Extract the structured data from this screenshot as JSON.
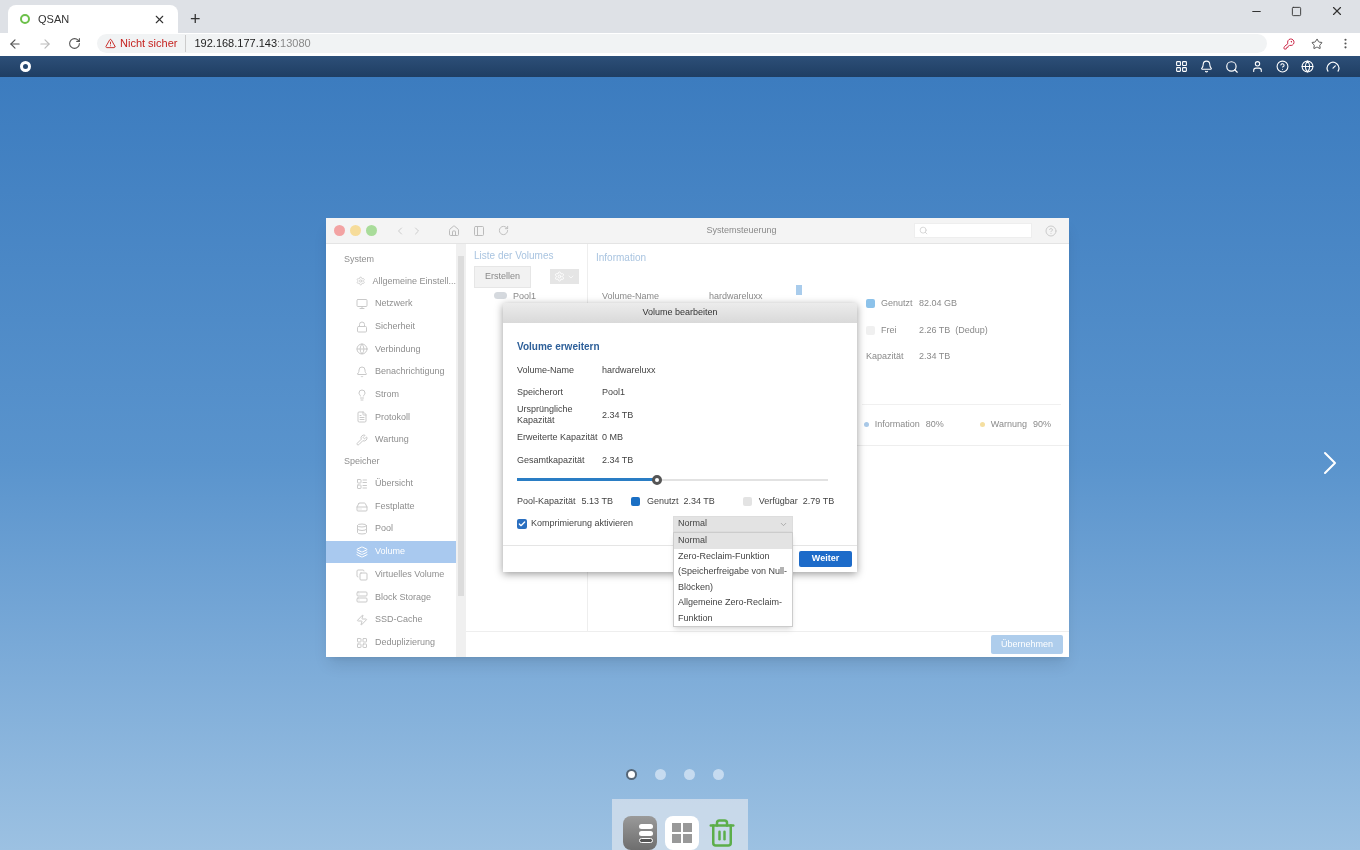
{
  "browser": {
    "tab": {
      "title": "QSAN"
    },
    "new_tab": "+",
    "address": {
      "security": "Nicht sicher",
      "host": "192.168.177.143",
      "port": ":13080"
    }
  },
  "window": {
    "title": "Systemsteuerung"
  },
  "sidebar": {
    "groups": [
      {
        "label": "System",
        "items": [
          {
            "label": "Allgemeine Einstell...",
            "selected": false
          },
          {
            "label": "Netzwerk",
            "selected": false
          },
          {
            "label": "Sicherheit",
            "selected": false
          },
          {
            "label": "Verbindung",
            "selected": false
          },
          {
            "label": "Benachrichtigung",
            "selected": false
          },
          {
            "label": "Strom",
            "selected": false
          },
          {
            "label": "Protokoll",
            "selected": false
          },
          {
            "label": "Wartung",
            "selected": false
          }
        ]
      },
      {
        "label": "Speicher",
        "items": [
          {
            "label": "Übersicht",
            "selected": false
          },
          {
            "label": "Festplatte",
            "selected": false
          },
          {
            "label": "Pool",
            "selected": false
          },
          {
            "label": "Volume",
            "selected": true
          },
          {
            "label": "Virtuelles Volume",
            "selected": false
          },
          {
            "label": "Block Storage",
            "selected": false
          },
          {
            "label": "SSD-Cache",
            "selected": false
          },
          {
            "label": "Deduplizierung",
            "selected": false
          }
        ]
      }
    ]
  },
  "volume_list": {
    "title": "Liste der Volumes",
    "create_button": "Erstellen",
    "tree": [
      {
        "label": "Pool1"
      }
    ]
  },
  "information": {
    "title": "Information",
    "fields": [
      {
        "label": "Volume-Name",
        "value": "hardwareluxx"
      }
    ],
    "legend": [
      {
        "label": "Genutzt",
        "value": "82.04 GB",
        "color": "#8cc2ea"
      },
      {
        "label": "Frei",
        "value": "2.26 TB  (Dedup)",
        "color": "#f0f0f0"
      }
    ],
    "capacity": {
      "label": "Kapazität",
      "value": "2.34 TB"
    },
    "thresholds": [
      {
        "label": "Information",
        "value": "80%",
        "color": "#a9c9e8"
      },
      {
        "label": "Warnung",
        "value": "90%",
        "color": "#f5dfa0"
      }
    ]
  },
  "apply_button": {
    "label": "Übernehmen",
    "disabled": true
  },
  "dialog": {
    "title": "Volume bearbeiten",
    "section": "Volume erweitern",
    "fields": [
      {
        "label": "Volume-Name",
        "value": "hardwareluxx"
      },
      {
        "label": "Speicherort",
        "value": "Pool1"
      },
      {
        "label": "Ursprüngliche Kapazität",
        "value": "2.34 TB"
      },
      {
        "label": "Erweiterte Kapazität",
        "value": "0 MB"
      },
      {
        "label": "Gesamtkapazität",
        "value": "2.34 TB"
      }
    ],
    "slider": {
      "level": 0.45
    },
    "pool": {
      "label": "Pool-Kapazität",
      "value": "5.13 TB"
    },
    "legend": [
      {
        "label": "Genutzt",
        "value": "2.34 TB",
        "color": "#1a6fc4"
      },
      {
        "label": "Verfügbar",
        "value": "2.79 TB",
        "color": "#e3e3e3"
      }
    ],
    "compression": {
      "label": "Komprimierung aktivieren",
      "checked": true
    },
    "select": {
      "value": "Normal",
      "expanded": true,
      "options": [
        {
          "label": "Normal",
          "selected": true
        },
        {
          "label": "Zero-Reclaim-Funktion (Speicherfreigabe von Null-Blöcken)",
          "selected": false
        },
        {
          "label": "Allgemeine Zero-Reclaim-Funktion",
          "selected": false
        }
      ]
    },
    "next_button": "Weiter"
  },
  "pages": [
    {
      "selected": true
    },
    {
      "selected": false
    },
    {
      "selected": false
    },
    {
      "selected": false
    }
  ]
}
